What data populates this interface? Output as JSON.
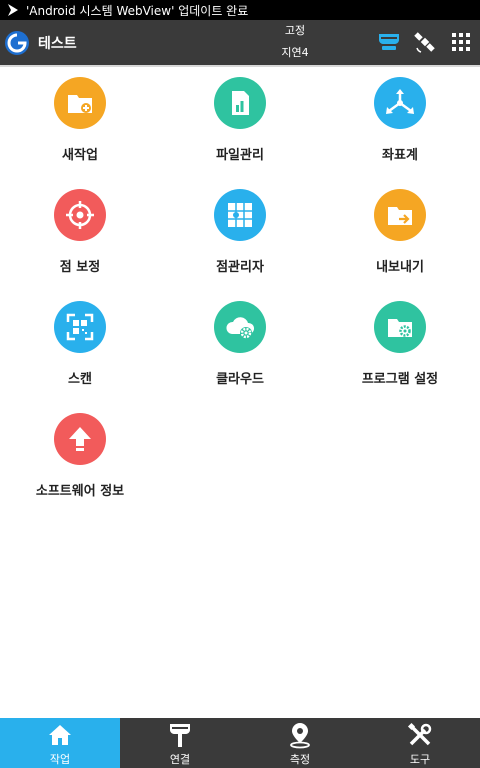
{
  "status_bar": {
    "notification": "'Android 시스템 WebView' 업데이트 완료"
  },
  "header": {
    "title": "테스트",
    "fix_status": "고정",
    "latency": "지연4",
    "icons": [
      "device-icon",
      "satellite-icon",
      "apps-grid-icon"
    ]
  },
  "menu": [
    {
      "label": "새작업",
      "icon": "new-folder-icon",
      "color": "#f5a623"
    },
    {
      "label": "파일관리",
      "icon": "file-chart-icon",
      "color": "#2fc3a0"
    },
    {
      "label": "좌표계",
      "icon": "axes-icon",
      "color": "#29b0ec"
    },
    {
      "label": "점 보정",
      "icon": "crosshair-icon",
      "color": "#f25b5b"
    },
    {
      "label": "점관리자",
      "icon": "point-grid-icon",
      "color": "#29b0ec"
    },
    {
      "label": "내보내기",
      "icon": "export-folder-icon",
      "color": "#f5a623"
    },
    {
      "label": "스캔",
      "icon": "qr-scan-icon",
      "color": "#29b0ec"
    },
    {
      "label": "클라우드",
      "icon": "cloud-gear-icon",
      "color": "#2fc3a0"
    },
    {
      "label": "프로그램 설정",
      "icon": "folder-gear-icon",
      "color": "#2fc3a0"
    },
    {
      "label": "소프트웨어 정보",
      "icon": "upload-arrow-icon",
      "color": "#f25b5b"
    }
  ],
  "bottom_nav": [
    {
      "label": "작업",
      "icon": "home-icon",
      "active": true
    },
    {
      "label": "연결",
      "icon": "receiver-icon",
      "active": false
    },
    {
      "label": "측정",
      "icon": "location-pin-icon",
      "active": false
    },
    {
      "label": "도구",
      "icon": "tools-icon",
      "active": false
    }
  ],
  "colors": {
    "accent": "#29b0ec",
    "header_bg": "#3a3a3a"
  }
}
